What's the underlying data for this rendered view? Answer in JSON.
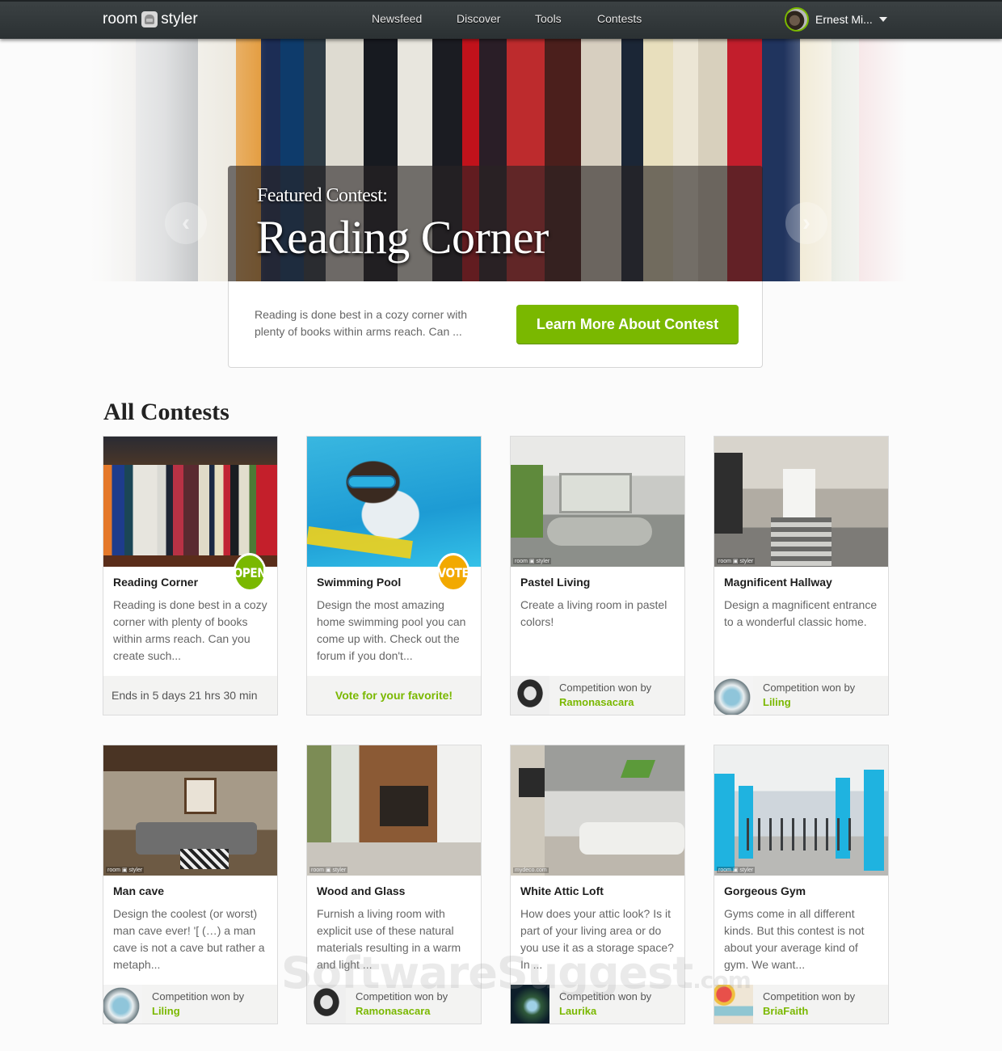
{
  "topbar": {
    "logo_left": "room",
    "logo_right": "styler",
    "nav": [
      {
        "label": "Newsfeed"
      },
      {
        "label": "Discover"
      },
      {
        "label": "Tools"
      },
      {
        "label": "Contests"
      }
    ],
    "user_name": "Ernest Mi..."
  },
  "hero": {
    "featured_label": "Featured Contest:",
    "featured_title": "Reading Corner",
    "description": "Reading is done best in a cozy corner with plenty of books within arms reach. Can ...",
    "cta_label": "Learn More About Contest",
    "prev_icon": "‹",
    "next_icon": "›"
  },
  "section_title": "All Contests",
  "colors": {
    "accent": "#7ab800",
    "open_badge": "#7ab800",
    "vote_badge": "#f2a900",
    "nav_bg": "#2f3537"
  },
  "contests": [
    {
      "title": "Reading Corner",
      "description": "Reading is done best in a cozy corner with plenty of books within arms reach. Can you create such...",
      "status": "OPEN",
      "footer_text": "Ends in 5 days 21 hrs 30 min"
    },
    {
      "title": "Swimming Pool",
      "description": "Design the most amazing home swimming pool you can come up with. Check out the forum if you don't...",
      "status": "VOTE",
      "footer_text": "Vote for your favorite!"
    },
    {
      "title": "Pastel Living",
      "description": "Create a living room in pastel colors!",
      "won_label": "Competition won by",
      "winner": "Ramonasacara",
      "watermark": "room ▣ styler"
    },
    {
      "title": "Magnificent Hallway",
      "description": "Design a magnificent entrance to a wonderful classic home.",
      "won_label": "Competition won by",
      "winner": "Liling",
      "watermark": "room ▣ styler"
    },
    {
      "title": "Man cave",
      "description": "Design the coolest (or worst) man cave ever! '[ (…) a man cave is not a cave but rather a metaph...",
      "won_label": "Competition won by",
      "winner": "Liling",
      "watermark": "room ▣ styler"
    },
    {
      "title": "Wood and Glass",
      "description": "Furnish a living room with explicit use of these natural materials resulting in a warm and light ...",
      "won_label": "Competition won by",
      "winner": "Ramonasacara",
      "watermark": "room ▣ styler"
    },
    {
      "title": "White Attic Loft",
      "description": "How does your attic look? Is it part of your living area or do you use it as a storage space? In ...",
      "won_label": "Competition won by",
      "winner": "Laurika",
      "watermark": "mydeco.com"
    },
    {
      "title": "Gorgeous Gym",
      "description": "Gyms come in all different kinds. But this contest is not about your average kind of gym. We want...",
      "won_label": "Competition won by",
      "winner": "BriaFaith",
      "watermark": "room ▣ styler"
    }
  ],
  "page_watermark": {
    "main": "SoftwareSuggest",
    "suffix": ".com"
  }
}
